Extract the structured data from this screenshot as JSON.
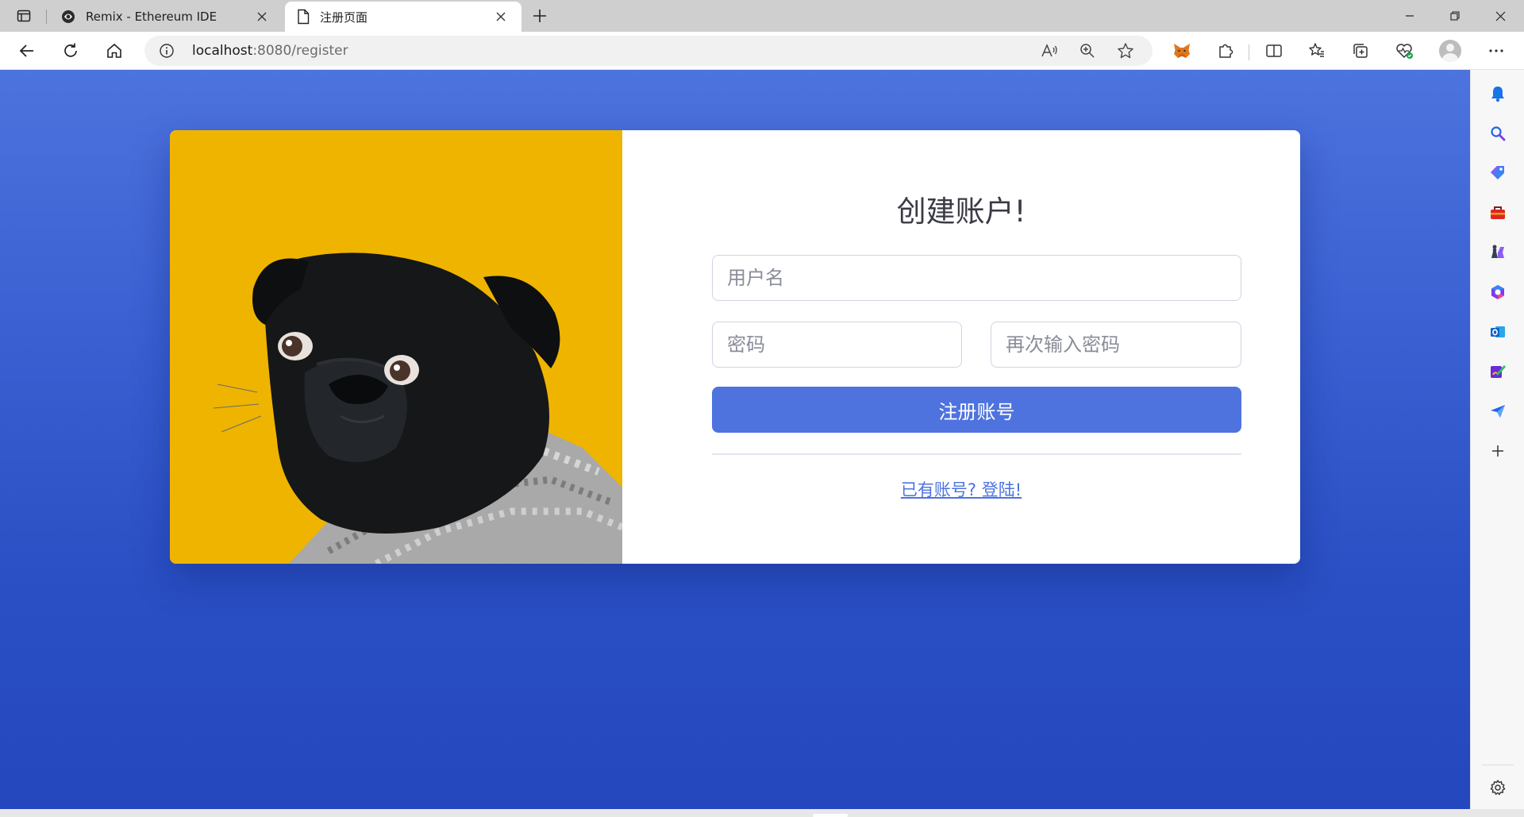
{
  "browser": {
    "tabs": [
      {
        "title": "Remix - Ethereum IDE",
        "icon": "remix-icon",
        "active": false
      },
      {
        "title": "注册页面",
        "icon": "page-icon",
        "active": true
      }
    ],
    "address": {
      "host": "localhost",
      "rest": ":8080/register"
    }
  },
  "page": {
    "title": "创建账户!",
    "fields": {
      "username_placeholder": "用户名",
      "password_placeholder": "密码",
      "confirm_placeholder": "再次输入密码"
    },
    "submit_label": "注册账号",
    "login_link": "已有账号? 登陆!",
    "colors": {
      "primary": "#4e73df",
      "hero_background": "#efb400",
      "page_background": "#3a60d2"
    }
  },
  "sidebar": {
    "items": [
      "bell-icon",
      "search-icon",
      "tag-icon",
      "toolbox-icon",
      "games-icon",
      "office-icon",
      "outlook-icon",
      "designer-icon",
      "send-icon",
      "add-icon"
    ],
    "footer": "settings-icon"
  }
}
